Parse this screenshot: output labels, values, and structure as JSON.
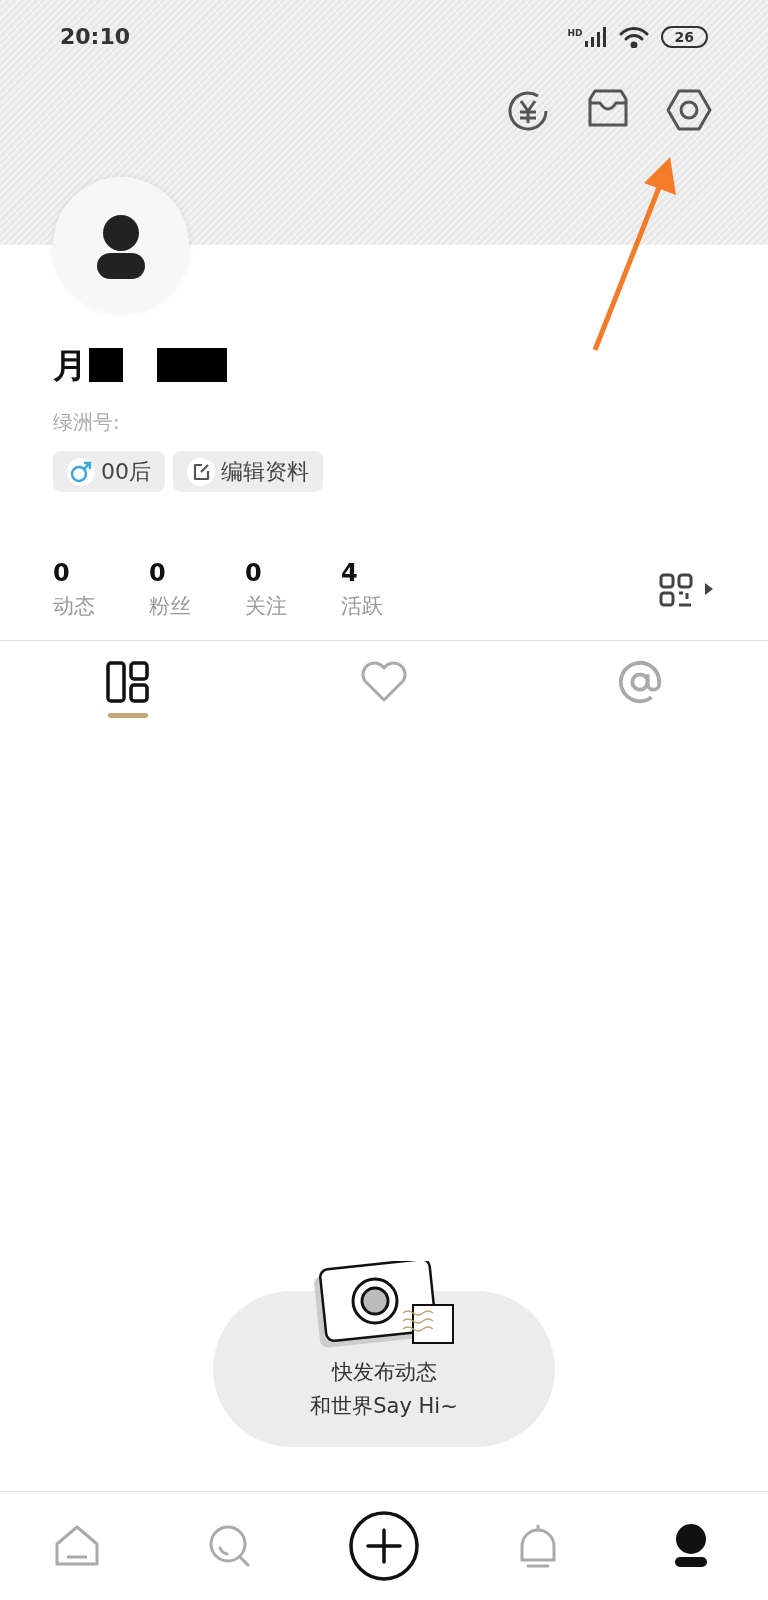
{
  "status_bar": {
    "time": "20:10",
    "network": "HD",
    "battery": "26"
  },
  "profile": {
    "name": "月",
    "id_label": "绿洲号:",
    "tags": [
      {
        "kind": "gender",
        "label": "00后"
      },
      {
        "kind": "edit",
        "label": "编辑资料"
      }
    ]
  },
  "stats": [
    {
      "value": "0",
      "label": "动态"
    },
    {
      "value": "0",
      "label": "粉丝"
    },
    {
      "value": "0",
      "label": "关注"
    },
    {
      "value": "4",
      "label": "活跃"
    }
  ],
  "tabs": [
    {
      "kind": "posts",
      "selected": true
    },
    {
      "kind": "likes",
      "selected": false
    },
    {
      "kind": "mentions",
      "selected": false
    }
  ],
  "empty_state": {
    "lines": [
      "快发布动态",
      "和世界Say Hi~"
    ]
  },
  "bottom_nav": [
    {
      "kind": "home",
      "selected": false
    },
    {
      "kind": "discover",
      "selected": false
    },
    {
      "kind": "add",
      "selected": false
    },
    {
      "kind": "notifications",
      "selected": false
    },
    {
      "kind": "profile",
      "selected": true
    }
  ]
}
